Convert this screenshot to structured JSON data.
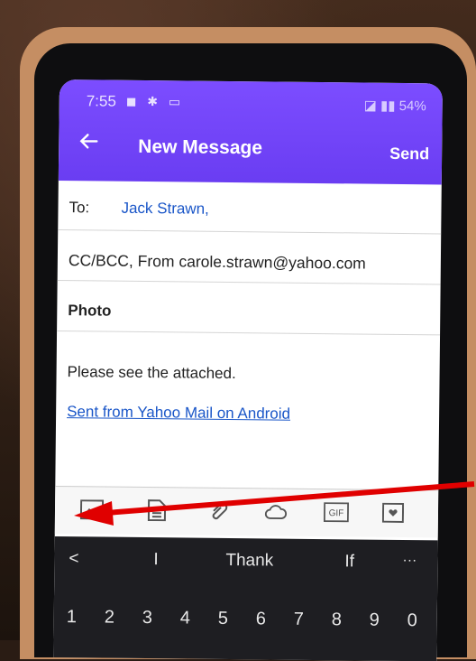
{
  "status_bar": {
    "time": "7:55",
    "icons": "◼ ✱ ▭",
    "right": "54%"
  },
  "header": {
    "title": "New Message",
    "send_label": "Send",
    "back_icon": "arrow-left-icon"
  },
  "fields": {
    "to_label": "To:",
    "to_value": "Jack Strawn,",
    "cc_text": "CC/BCC, From carole.strawn@yahoo.com",
    "subject": "Photo"
  },
  "body": {
    "text": "Please see the attached.",
    "signature_link": "Sent from Yahoo Mail on Android"
  },
  "toolbar": {
    "icons": [
      "image-icon",
      "file-icon",
      "paperclip-icon",
      "cloud-icon",
      "gif-icon",
      "sticker-icon"
    ],
    "gif_label": "GIF"
  },
  "keyboard": {
    "back": "<",
    "suggestions": [
      "I",
      "Thank",
      "If"
    ],
    "more": "···",
    "numbers": [
      "1",
      "2",
      "3",
      "4",
      "5",
      "6",
      "7",
      "8",
      "9",
      "0"
    ]
  },
  "colors": {
    "app_purple": "#6a3df2",
    "link_blue": "#1a56c8",
    "arrow_red": "#e00000"
  }
}
